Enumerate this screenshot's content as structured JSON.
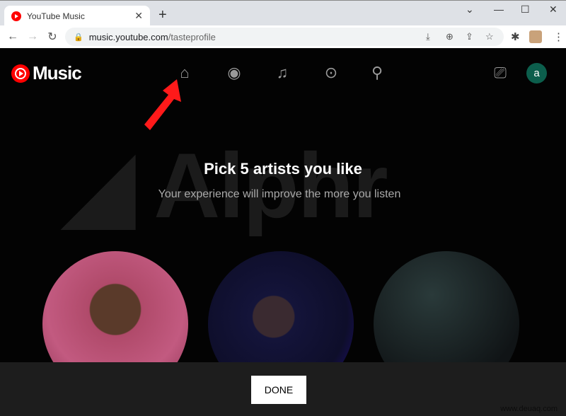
{
  "browser": {
    "tab_title": "YouTube Music",
    "url_domain": "music.youtube.com",
    "url_path": "/tasteprofile"
  },
  "header": {
    "logo_text": "Music",
    "nav": [
      "home",
      "explore",
      "library",
      "upgrade",
      "search"
    ],
    "avatar_letter": "a"
  },
  "main": {
    "title": "Pick 5 artists you like",
    "subtitle": "Your experience will improve the more you listen"
  },
  "footer": {
    "done_label": "DONE"
  },
  "watermarks": {
    "overlay": "Alphr",
    "site": "www.deuaq.com"
  },
  "colors": {
    "brand": "#ff0000",
    "avatar": "#0c5e4c",
    "arrow": "#ff1a1a"
  }
}
